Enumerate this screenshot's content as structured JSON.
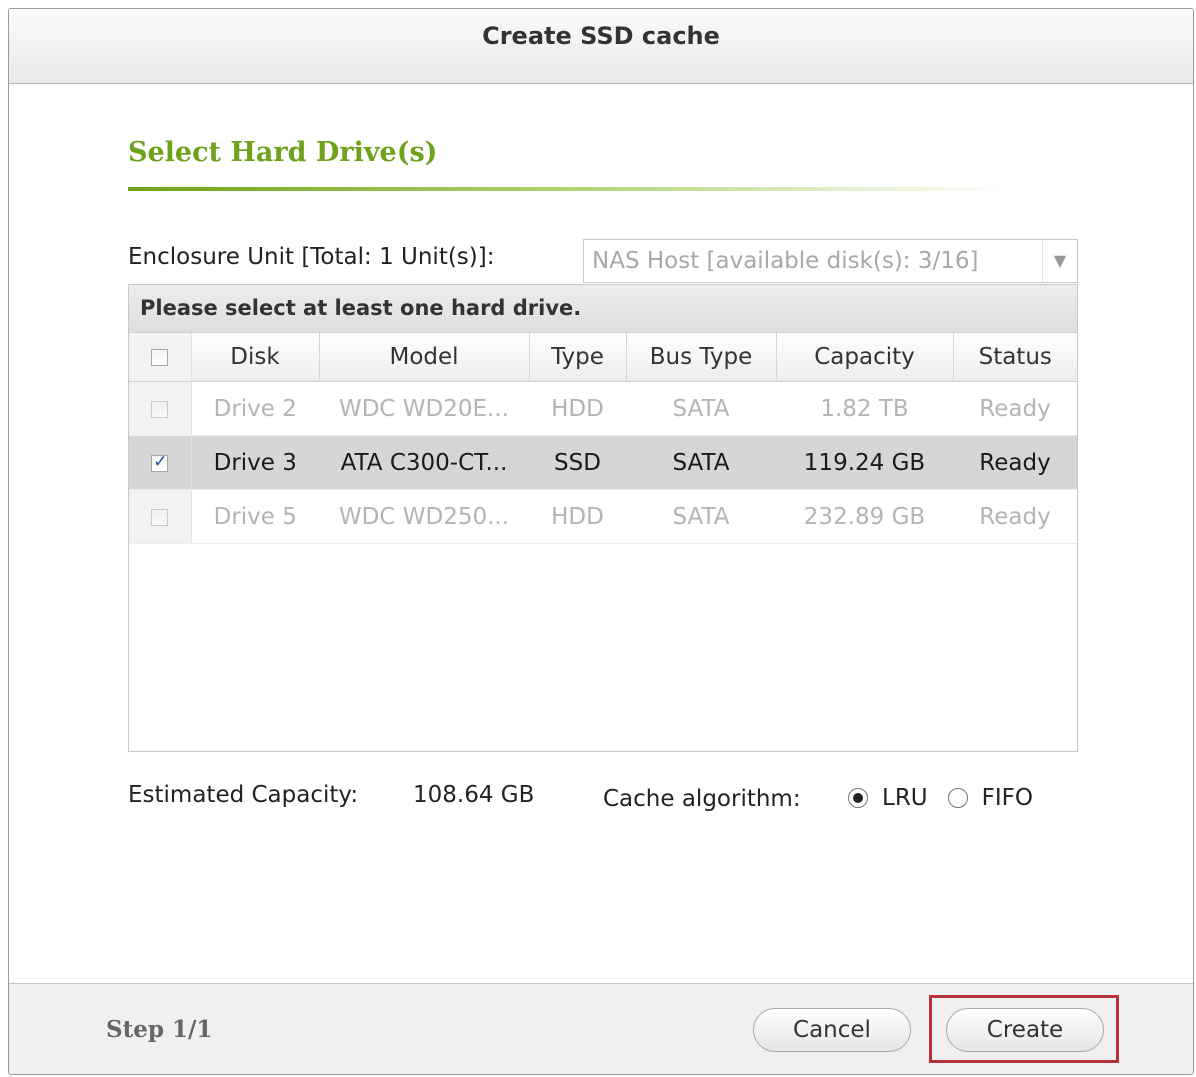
{
  "dialog": {
    "title": "Create SSD cache"
  },
  "section": {
    "title": "Select Hard Drive(s)"
  },
  "enclosure": {
    "label": "Enclosure Unit [Total: 1 Unit(s)]:",
    "selected": "NAS Host [available disk(s): 3/16]"
  },
  "grid": {
    "caption": "Please select at least one hard drive.",
    "columns": [
      "Disk",
      "Model",
      "Type",
      "Bus Type",
      "Capacity",
      "Status"
    ],
    "rows": [
      {
        "checked": false,
        "enabled": false,
        "disk": "Drive 2",
        "model": "WDC WD20E...",
        "type": "HDD",
        "bus": "SATA",
        "capacity": "1.82 TB",
        "status": "Ready"
      },
      {
        "checked": true,
        "enabled": true,
        "disk": "Drive 3",
        "model": "ATA C300-CT...",
        "type": "SSD",
        "bus": "SATA",
        "capacity": "119.24 GB",
        "status": "Ready"
      },
      {
        "checked": false,
        "enabled": false,
        "disk": "Drive 5",
        "model": "WDC WD250...",
        "type": "HDD",
        "bus": "SATA",
        "capacity": "232.89 GB",
        "status": "Ready"
      }
    ]
  },
  "capacity": {
    "label": "Estimated Capacity:",
    "value": "108.64 GB"
  },
  "algorithm": {
    "label": "Cache algorithm:",
    "options": [
      "LRU",
      "FIFO"
    ],
    "selected": "LRU"
  },
  "footer": {
    "step": "Step 1/1",
    "cancel_label": "Cancel",
    "create_label": "Create",
    "highlight_color": "#b5323a"
  },
  "colors": {
    "accent_green": "#6ea21c",
    "selected_row": "#d6d6d6"
  }
}
